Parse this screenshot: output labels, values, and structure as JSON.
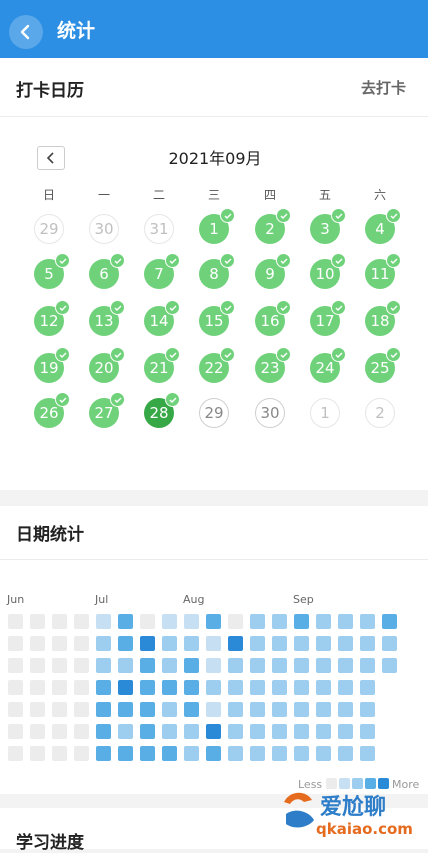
{
  "header": {
    "title": "统计"
  },
  "calendar_section": {
    "title": "打卡日历",
    "checkin_link": "去打卡",
    "month": "2021年09月",
    "weekdays": [
      "日",
      "一",
      "二",
      "三",
      "四",
      "五",
      "六"
    ],
    "days": [
      {
        "label": "29",
        "state": "prev"
      },
      {
        "label": "30",
        "state": "prev"
      },
      {
        "label": "31",
        "state": "prev"
      },
      {
        "label": "1",
        "state": "done"
      },
      {
        "label": "2",
        "state": "done"
      },
      {
        "label": "3",
        "state": "done"
      },
      {
        "label": "4",
        "state": "done"
      },
      {
        "label": "5",
        "state": "done"
      },
      {
        "label": "6",
        "state": "done"
      },
      {
        "label": "7",
        "state": "done"
      },
      {
        "label": "8",
        "state": "done"
      },
      {
        "label": "9",
        "state": "done"
      },
      {
        "label": "10",
        "state": "done"
      },
      {
        "label": "11",
        "state": "done"
      },
      {
        "label": "12",
        "state": "done"
      },
      {
        "label": "13",
        "state": "done"
      },
      {
        "label": "14",
        "state": "done"
      },
      {
        "label": "15",
        "state": "done"
      },
      {
        "label": "16",
        "state": "done"
      },
      {
        "label": "17",
        "state": "done"
      },
      {
        "label": "18",
        "state": "done"
      },
      {
        "label": "19",
        "state": "done"
      },
      {
        "label": "20",
        "state": "done"
      },
      {
        "label": "21",
        "state": "done"
      },
      {
        "label": "22",
        "state": "done"
      },
      {
        "label": "23",
        "state": "done"
      },
      {
        "label": "24",
        "state": "done"
      },
      {
        "label": "25",
        "state": "done"
      },
      {
        "label": "26",
        "state": "done"
      },
      {
        "label": "27",
        "state": "done"
      },
      {
        "label": "28",
        "state": "today"
      },
      {
        "label": "29",
        "state": "undone"
      },
      {
        "label": "30",
        "state": "undone"
      },
      {
        "label": "1",
        "state": "next"
      },
      {
        "label": "2",
        "state": "next"
      }
    ]
  },
  "date_stats": {
    "title": "日期统计",
    "months": [
      "Jun",
      "Jul",
      "Aug",
      "Sep"
    ],
    "legend_less": "Less",
    "legend_more": "More",
    "levels_by_week": [
      [
        0,
        0,
        0,
        0,
        0,
        0,
        0
      ],
      [
        0,
        0,
        0,
        0,
        0,
        0,
        0
      ],
      [
        0,
        0,
        0,
        0,
        0,
        0,
        0
      ],
      [
        0,
        0,
        0,
        0,
        0,
        0,
        0
      ],
      [
        1,
        2,
        2,
        3,
        3,
        3,
        3
      ],
      [
        3,
        3,
        2,
        4,
        3,
        2,
        3
      ],
      [
        0,
        4,
        3,
        3,
        3,
        3,
        3
      ],
      [
        1,
        2,
        2,
        3,
        2,
        2,
        3
      ],
      [
        1,
        2,
        3,
        3,
        3,
        2,
        2
      ],
      [
        3,
        1,
        1,
        2,
        1,
        4,
        3
      ],
      [
        0,
        4,
        2,
        2,
        2,
        2,
        2
      ],
      [
        2,
        2,
        2,
        2,
        2,
        2,
        2
      ],
      [
        2,
        2,
        2,
        2,
        2,
        2,
        2
      ],
      [
        3,
        2,
        2,
        2,
        2,
        2,
        2
      ],
      [
        2,
        2,
        2,
        2,
        2,
        2,
        2
      ],
      [
        2,
        2,
        2,
        2,
        2,
        2,
        2
      ],
      [
        2,
        2,
        2,
        2,
        2,
        2,
        2
      ],
      [
        3,
        2,
        2,
        -1,
        -1,
        -1,
        -1
      ]
    ],
    "colors": [
      "#ececec",
      "#c6dff3",
      "#9dcdef",
      "#5aaee6",
      "#2a8ad8"
    ]
  },
  "progress_section": {
    "title": "学习进度"
  },
  "watermark": {
    "main": "爱尬聊",
    "sub": "qkaiao.com"
  }
}
